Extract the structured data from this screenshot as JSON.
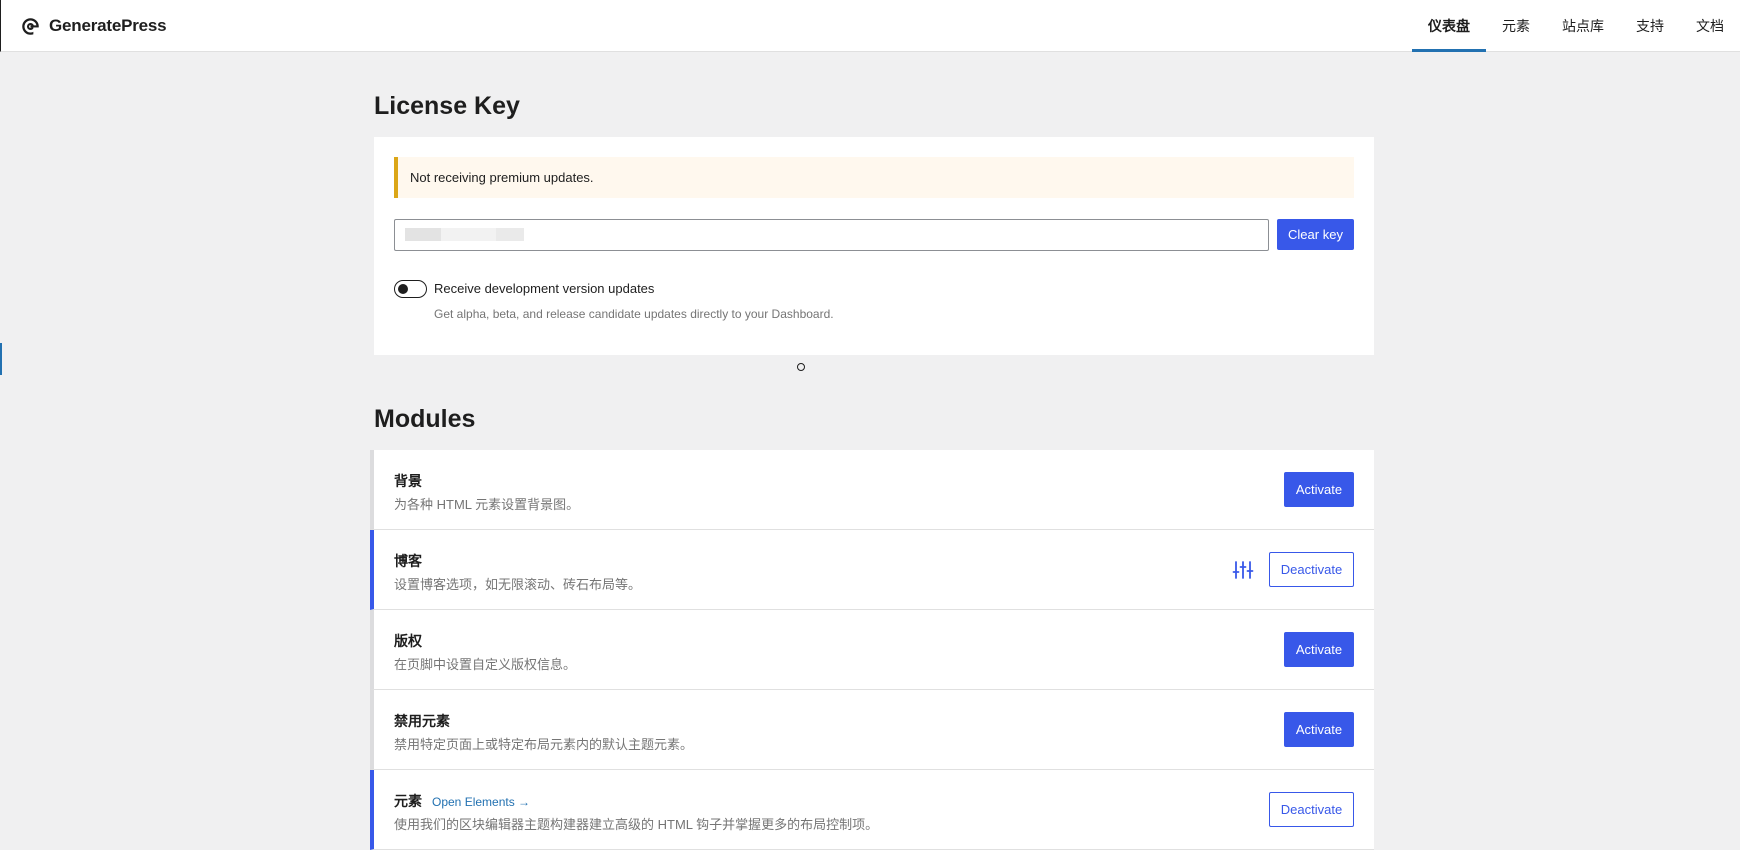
{
  "brand": {
    "name": "GeneratePress"
  },
  "nav": {
    "tabs": [
      {
        "label": "仪表盘",
        "active": true
      },
      {
        "label": "元素",
        "active": false
      },
      {
        "label": "站点库",
        "active": false
      },
      {
        "label": "支持",
        "active": false
      },
      {
        "label": "文档",
        "active": false
      }
    ]
  },
  "license": {
    "title": "License Key",
    "notice": "Not receiving premium updates.",
    "clear_label": "Clear key",
    "toggle_label": "Receive development version updates",
    "toggle_help": "Get alpha, beta, and release candidate updates directly to your Dashboard.",
    "toggle_on": false
  },
  "modules": {
    "title": "Modules",
    "items": [
      {
        "name": "背景",
        "desc": "为各种 HTML 元素设置背景图。",
        "button": "Activate",
        "active": false
      },
      {
        "name": "博客",
        "desc": "设置博客选项，如无限滚动、砖石布局等。",
        "button": "Deactivate",
        "active": true,
        "settings_icon": "sliders-icon"
      },
      {
        "name": "版权",
        "desc": "在页脚中设置自定义版权信息。",
        "button": "Activate",
        "active": false
      },
      {
        "name": "禁用元素",
        "desc": "禁用特定页面上或特定布局元素内的默认主题元素。",
        "button": "Activate",
        "active": false
      },
      {
        "name": "元素",
        "link": "Open Elements →",
        "desc": "使用我们的区块编辑器主题构建器建立高级的 HTML 钩子并掌握更多的布局控制项。",
        "button": "Deactivate",
        "active": true
      }
    ]
  },
  "colors": {
    "accent": "#3858e9",
    "tab_underline": "#2271b1",
    "notice_border": "#dba617",
    "notice_bg": "#fff8ee"
  }
}
